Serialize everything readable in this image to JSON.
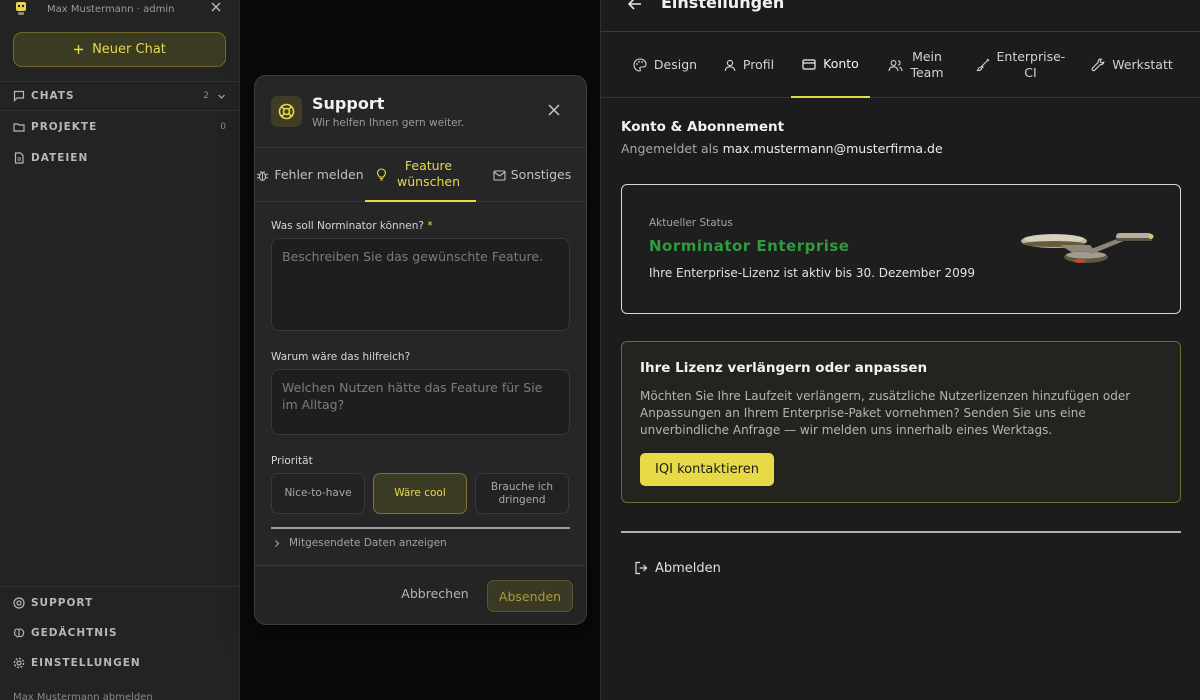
{
  "sidebar": {
    "username": "Max Mustermann · admin",
    "new_chat": "Neuer Chat",
    "nav": [
      {
        "label": "CHATS",
        "count": "2"
      },
      {
        "label": "PROJEKTE",
        "count": "0"
      },
      {
        "label": "DATEIEN"
      }
    ],
    "bottom": [
      {
        "label": "SUPPORT"
      },
      {
        "label": "GEDÄCHTNIS"
      },
      {
        "label": "EINSTELLUNGEN"
      }
    ],
    "logout": "Max Mustermann abmelden"
  },
  "support_modal": {
    "title": "Support",
    "subtitle": "Wir helfen Ihnen gern weiter.",
    "tabs": [
      {
        "label": "Fehler melden"
      },
      {
        "label": "Feature wünschen",
        "active": true
      },
      {
        "label": "Sonstiges"
      }
    ],
    "field1": {
      "label": "Was soll Norminator können?",
      "required_mark": "*",
      "placeholder": "Beschreiben Sie das gewünschte Feature."
    },
    "field2": {
      "label": "Warum wäre das hilfreich?",
      "placeholder": "Welchen Nutzen hätte das Feature für Sie im Alltag?"
    },
    "priority": {
      "label": "Priorität",
      "options": [
        "Nice-to-have",
        "Wäre cool",
        "Brauche ich dringend"
      ],
      "selected": "Wäre cool"
    },
    "sent_data_toggle": "Mitgesendete Daten anzeigen",
    "cancel": "Abbrechen",
    "submit": "Absenden"
  },
  "settings": {
    "title": "Einstellungen",
    "tabs": [
      {
        "label": "Design"
      },
      {
        "label": "Profil"
      },
      {
        "label": "Konto",
        "active": true
      },
      {
        "label": "Mein Team"
      },
      {
        "label": "Enterprise-CI"
      },
      {
        "label": "Werkstatt"
      }
    ],
    "account": {
      "title": "Konto & Abonnement",
      "logged_in_prefix": "Angemeldet als",
      "email": "max.mustermann@musterfirma.de"
    },
    "status": {
      "label": "Aktueller Status",
      "plan": "Norminator Enterprise",
      "desc_prefix": "Ihre Enterprise-Lizenz ist aktiv bis",
      "valid_until": "30. Dezember 2099"
    },
    "license": {
      "title": "Ihre Lizenz verlängern oder anpassen",
      "text": "Möchten Sie Ihre Laufzeit verlängern, zusätzliche Nutzerlizenzen hinzufügen oder Anpassungen an Ihrem Enterprise-Paket vornehmen? Senden Sie uns eine unverbindliche Anfrage — wir melden uns innerhalb eines Werktags.",
      "button": "IQI kontaktieren"
    },
    "logout": "Abmelden"
  },
  "colors": {
    "accent": "#e6d94c",
    "status_green": "#2f9a3e",
    "background": "#1c1c1c"
  }
}
